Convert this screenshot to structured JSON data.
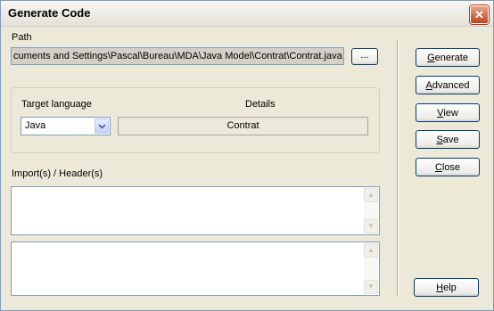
{
  "window": {
    "title": "Generate Code",
    "close_glyph": "✕"
  },
  "path": {
    "label": "Path",
    "value": "cuments and Settings\\Pascal\\Bureau\\MDA\\Java Model\\Contrat\\Contrat.java",
    "browse_label": "..."
  },
  "language": {
    "label": "Target language",
    "selected": "Java",
    "dropdown_icon": "chevron-down-icon"
  },
  "details": {
    "label": "Details",
    "value": "Contrat"
  },
  "imports": {
    "label": "Import(s) / Header(s)"
  },
  "buttons": {
    "generate_pre": "",
    "generate_key": "G",
    "generate_post": "enerate",
    "advanced_pre": "",
    "advanced_key": "A",
    "advanced_post": "dvanced",
    "view_pre": "",
    "view_key": "V",
    "view_post": "iew",
    "save_pre": "",
    "save_key": "S",
    "save_post": "ave",
    "close_pre": "",
    "close_key": "C",
    "close_post": "lose",
    "help_pre": "",
    "help_key": "H",
    "help_post": "elp"
  },
  "scroll_glyphs": {
    "up": "▲",
    "down": "▼"
  }
}
